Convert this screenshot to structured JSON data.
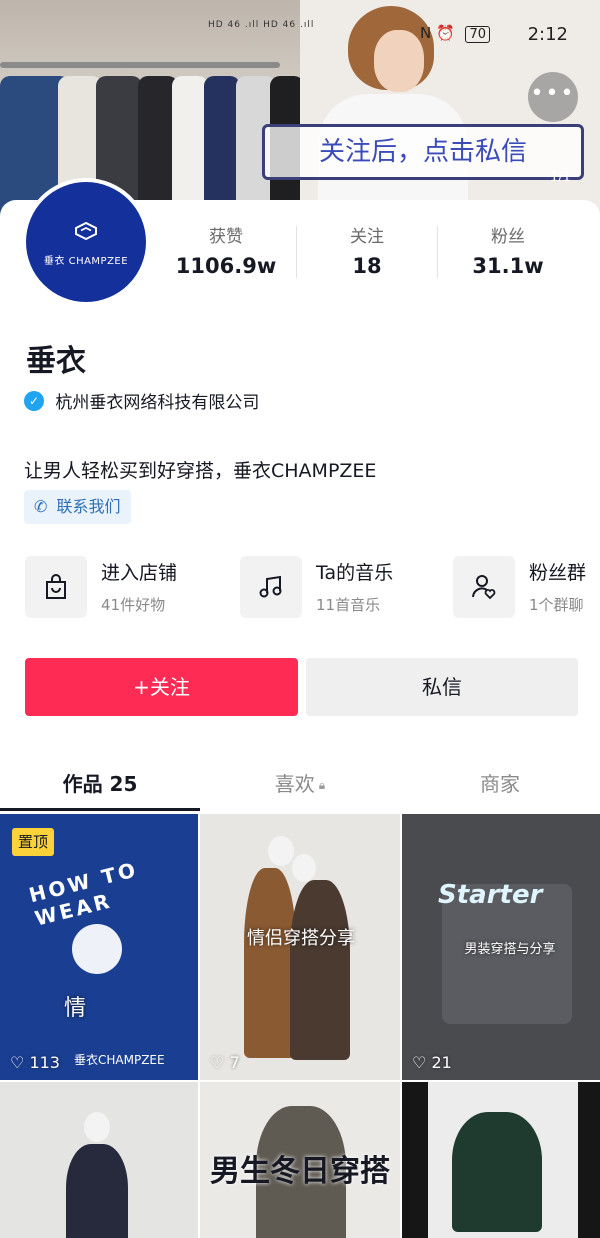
{
  "status_bar": {
    "network": "HD 46 .ıll HD 46 .ıll",
    "icons": "N ⏰",
    "battery": "70",
    "time": "2:12"
  },
  "cover": {
    "banner_text": "关注后，点击私信",
    "page_indicator": "1/1",
    "more_label": "•••"
  },
  "profile": {
    "avatar_text": "垂衣 CHAMPZEE",
    "stats": [
      {
        "label": "获赞",
        "value": "1106.9w"
      },
      {
        "label": "关注",
        "value": "18"
      },
      {
        "label": "粉丝",
        "value": "31.1w"
      }
    ],
    "nickname": "垂衣",
    "verified_org": "杭州垂衣网络科技有限公司",
    "bio": "让男人轻松买到好穿搭，垂衣CHAMPZEE",
    "contact_label": "联系我们"
  },
  "entries": [
    {
      "title": "进入店铺",
      "sub": "41件好物",
      "icon": "shopping-bag-icon"
    },
    {
      "title": "Ta的音乐",
      "sub": "11首音乐",
      "icon": "music-note-icon"
    },
    {
      "title": "粉丝群",
      "sub": "1个群聊",
      "icon": "fan-group-icon"
    }
  ],
  "actions": {
    "follow_label": "+关注",
    "message_label": "私信"
  },
  "tabs": [
    {
      "label": "作品 25",
      "active": true
    },
    {
      "label": "喜欢",
      "locked": true
    },
    {
      "label": "商家"
    }
  ],
  "videos": [
    {
      "pinned_label": "置顶",
      "title": "HOW TO WEAR",
      "caption": "情",
      "likes": "113",
      "brand": "垂衣CHAMPZEE"
    },
    {
      "caption": "情侣穿搭分享",
      "likes": "7"
    },
    {
      "caption": "男装穿搭与分享",
      "likes": "21",
      "print": "Starter"
    },
    {
      "caption": ""
    },
    {
      "caption": "男生冬日穿搭"
    },
    {
      "caption": ""
    }
  ],
  "colors": {
    "accent": "#fe2c55",
    "verify_blue": "#20a4f0",
    "avatar_bg": "#14309a",
    "pin_yellow": "#fcd23a"
  }
}
